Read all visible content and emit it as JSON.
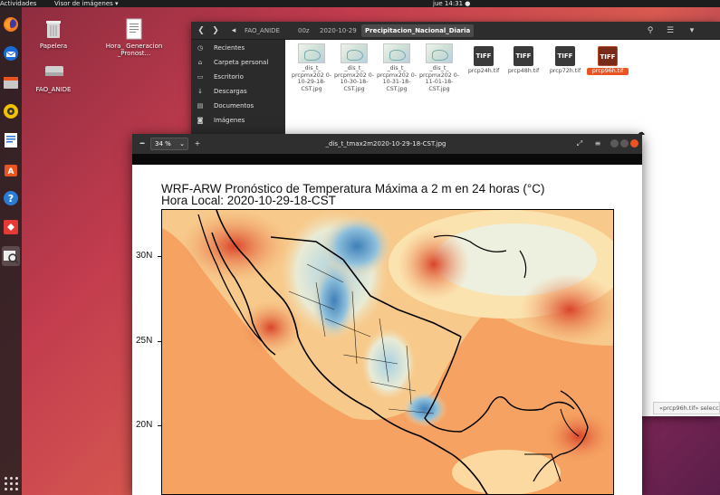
{
  "topbar": {
    "activities": "Actividades",
    "app_menu": "Visor de imágenes ▾",
    "clock": "jue 14:31 ●"
  },
  "desktop": {
    "icons": [
      {
        "label": "Papelera"
      },
      {
        "label": "Hora_ Generacion _Pronost..."
      },
      {
        "label": "FAO_ANIDE"
      }
    ]
  },
  "files": {
    "breadcrumbs": [
      "FAO_ANIDE",
      "00z",
      "2020-10-29",
      "Precipitacion_Nacional_Diaria"
    ],
    "sidebar": [
      {
        "label": "Recientes",
        "icon": "clock-icon"
      },
      {
        "label": "Carpeta personal",
        "icon": "home-icon"
      },
      {
        "label": "Escritorio",
        "icon": "folder-icon"
      },
      {
        "label": "Descargas",
        "icon": "download-icon"
      },
      {
        "label": "Documentos",
        "icon": "document-icon"
      },
      {
        "label": "Imágenes",
        "icon": "camera-icon"
      }
    ],
    "items": [
      {
        "name": "_dis_t_ prcpmx202 0-10-29-18- CST.jpg",
        "kind": "jpg"
      },
      {
        "name": "_dis_t_ prcpmx202 0-10-30-18- CST.jpg",
        "kind": "jpg"
      },
      {
        "name": "_dis_t_ prcpmx202 0-10-31-18- CST.jpg",
        "kind": "jpg"
      },
      {
        "name": "_dis_t_ prcpmx202 0-11-01-18- CST.jpg",
        "kind": "jpg"
      },
      {
        "name": "prcp24h.tif",
        "kind": "tif",
        "badge": "TIFF"
      },
      {
        "name": "prcp48h.tif",
        "kind": "tif",
        "badge": "TIFF"
      },
      {
        "name": "prcp72h.tif",
        "kind": "tif",
        "badge": "TIFF"
      },
      {
        "name": "prcp96h.tif",
        "kind": "tif",
        "badge": "TIFF",
        "selected": true
      }
    ],
    "status": "«prcp96h.tif» selecc"
  },
  "viewer": {
    "zoom": "34 %",
    "title": "_dis_t_tmax2m2020-10-29-18-CST.jpg",
    "plot_title": "WRF-ARW Pronóstico de Temperatura Máxima a 2 m en 24 horas (°C)",
    "plot_subtitle": "Hora Local: 2020-10-29-18-CST",
    "y_ticks": [
      "30N",
      "25N",
      "20N"
    ]
  },
  "colors": {
    "accent": "#e95420",
    "map_warm": "#f5a262",
    "map_cool": "#6ea7cf"
  }
}
